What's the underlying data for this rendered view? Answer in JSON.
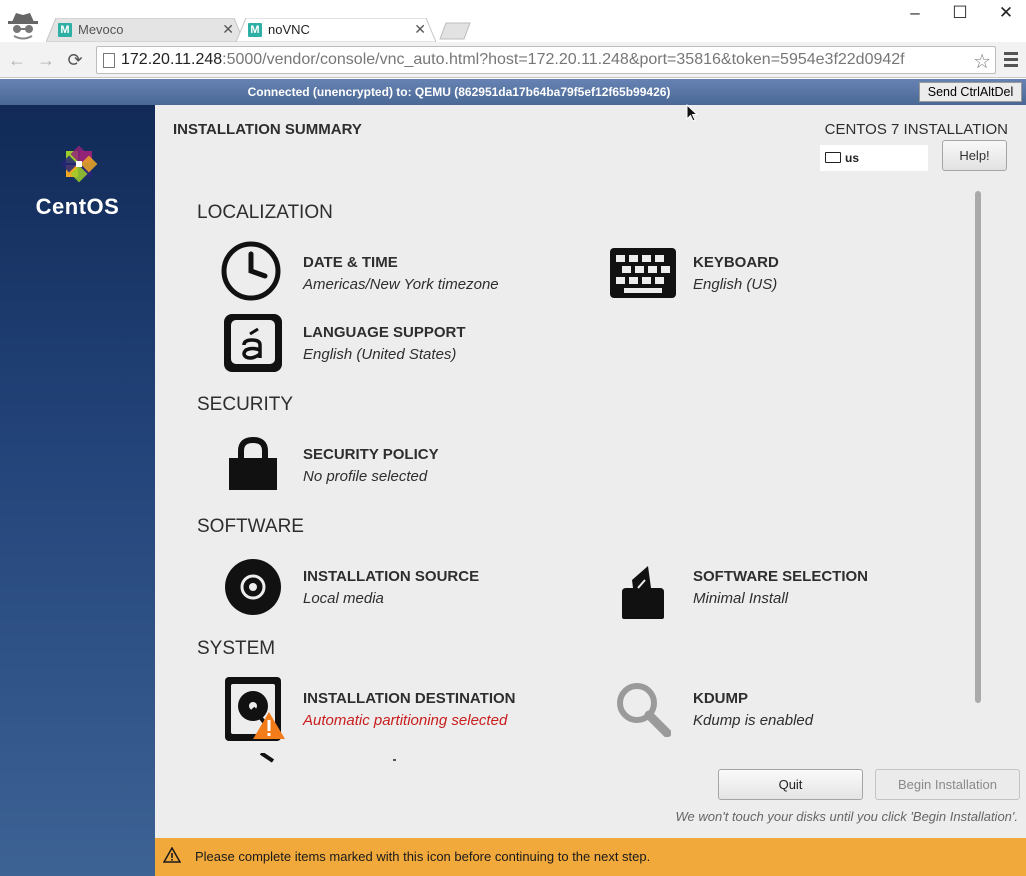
{
  "browser": {
    "tabs": [
      {
        "title": "Mevoco",
        "favicon": "M"
      },
      {
        "title": "noVNC",
        "favicon": "M"
      }
    ],
    "url": {
      "host": "172.20.11.248",
      "rest": ":5000/vendor/console/vnc_auto.html?host=172.20.11.248&port=35816&token=5954e3f22d0942f"
    },
    "window_controls": {
      "minimize": "–",
      "maximize": "☐",
      "close": "✕"
    }
  },
  "vnc": {
    "status": "Connected (unencrypted) to: QEMU (862951da17b64ba79f5ef12f65b99426)",
    "send_cad_label": "Send CtrlAltDel"
  },
  "sidebar": {
    "brand": "CentOS"
  },
  "header": {
    "title": "INSTALLATION SUMMARY",
    "product": "CENTOS 7 INSTALLATION",
    "keyboard_layout": "us",
    "help_label": "Help!"
  },
  "sections": {
    "localization": "LOCALIZATION",
    "security": "SECURITY",
    "software": "SOFTWARE",
    "system": "SYSTEM"
  },
  "spokes": {
    "datetime": {
      "name": "DATE & TIME",
      "status": "Americas/New York timezone"
    },
    "keyboard": {
      "name": "KEYBOARD",
      "status": "English (US)"
    },
    "language": {
      "name": "LANGUAGE SUPPORT",
      "status": "English (United States)"
    },
    "security_policy": {
      "name": "SECURITY POLICY",
      "status": "No profile selected"
    },
    "source": {
      "name": "INSTALLATION SOURCE",
      "status": "Local media"
    },
    "software": {
      "name": "SOFTWARE SELECTION",
      "status": "Minimal Install"
    },
    "destination": {
      "name": "INSTALLATION DESTINATION",
      "status": "Automatic partitioning selected"
    },
    "kdump": {
      "name": "KDUMP",
      "status": "Kdump is enabled"
    }
  },
  "buttons": {
    "quit": "Quit",
    "begin": "Begin Installation"
  },
  "note": "We won't touch your disks until you click 'Begin Installation'.",
  "warning": "Please complete items marked with this icon before continuing to the next step.",
  "colors": {
    "warning_bar": "#f2a93b",
    "warning_text": "#c91d1d",
    "vnc_bar": "#5573a5",
    "sidebar": "#1d3a6d"
  }
}
